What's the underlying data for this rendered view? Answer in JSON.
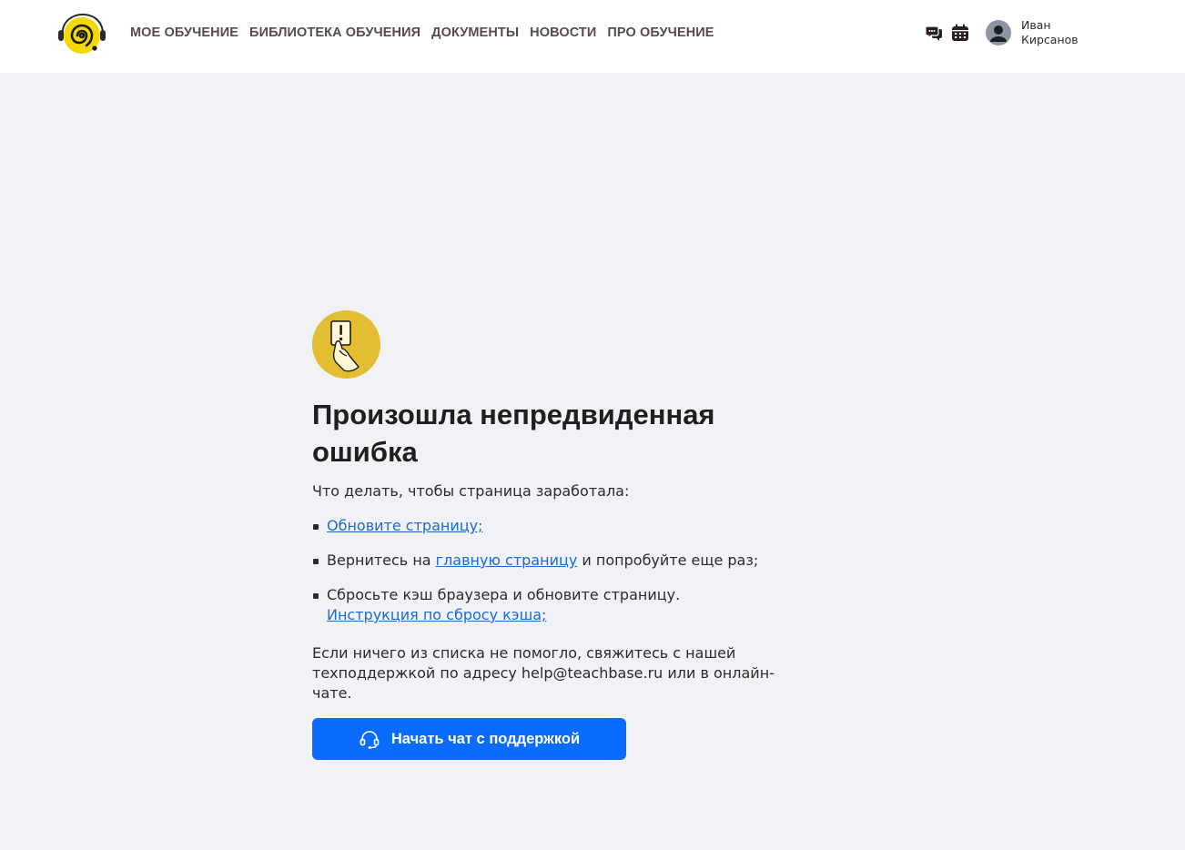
{
  "header": {
    "nav": [
      {
        "label": "МОЕ ОБУЧЕНИЕ"
      },
      {
        "label": "БИБЛИОТЕКА ОБУЧЕНИЯ"
      },
      {
        "label": "ДОКУМЕНТЫ"
      },
      {
        "label": "НОВОСТИ"
      },
      {
        "label": "ПРО ОБУЧЕНИЕ"
      }
    ],
    "icons": [
      "chat-icon",
      "calendar-icon"
    ],
    "user": {
      "first_name": "Иван",
      "last_name": "Кирсанов"
    }
  },
  "error": {
    "illustration": "warning-card-hand-icon",
    "title": "Произошла непредвиденная ошибка",
    "lead": "Что делать, чтобы страница заработала:",
    "steps": {
      "refresh_link": "Обновите страницу;",
      "home_prefix": "Вернитесь на",
      "home_link": "главную страницу",
      "home_suffix": "и попробуйте еще раз;",
      "cache_text": "Сбросьте кэш браузера и обновите страницу.",
      "cache_link": "Инструкция по сбросу кэша;"
    },
    "footnote": "Если ничего из списка не помогло, свяжитесь с нашей техподдержкой по адресу help@teachbase.ru или в онлайн-чате.",
    "chat_button": "Начать чат с поддержкой"
  },
  "colors": {
    "page_bg": "#f1f2f6",
    "accent_blue": "#0a6cff",
    "link_blue": "#1a6bd6",
    "brand_yellow": "#f5d800",
    "illustration_yellow": "#e3be33"
  }
}
